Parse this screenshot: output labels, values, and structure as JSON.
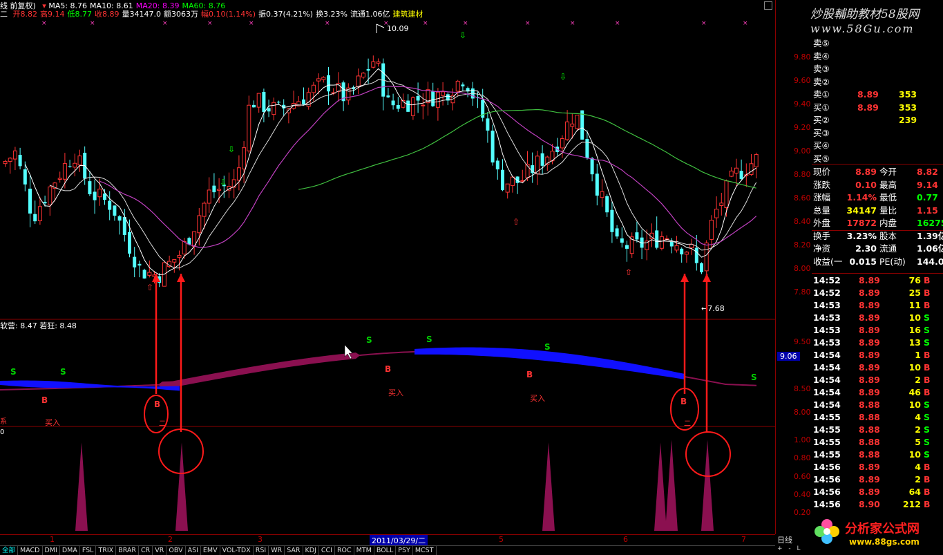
{
  "header": {
    "line1": {
      "title": "线 前复权)",
      "ma_items": [
        {
          "label": "MA5: 8.76",
          "color": "#ffffff"
        },
        {
          "label": "MA10: 8.61",
          "color": "#ffffff"
        },
        {
          "label": "MA20: 8.39",
          "color": "#ff00ff"
        },
        {
          "label": "MA60: 8.76",
          "color": "#00ff00"
        }
      ]
    },
    "line2": {
      "prefix": "二",
      "items": [
        {
          "label": "开8.82",
          "color": "#ff3333"
        },
        {
          "label": "高9.14",
          "color": "#ff3333"
        },
        {
          "label": "低8.77",
          "color": "#00ff00"
        },
        {
          "label": "收8.89",
          "color": "#ff3333"
        },
        {
          "label": "量34147.0",
          "color": "#ffffff"
        },
        {
          "label": "额3063万",
          "color": "#ffffff"
        },
        {
          "label": "幅0.10(1.14%)",
          "color": "#ff3333"
        },
        {
          "label": "振0.37(4.21%)",
          "color": "#ffffff"
        },
        {
          "label": "换3.23%",
          "color": "#ffffff"
        },
        {
          "label": "流通1.06亿",
          "color": "#ffffff"
        },
        {
          "label": "建筑建材",
          "color": "#ffff00"
        }
      ]
    }
  },
  "watermark": {
    "line1": "炒股輔助教材58股网",
    "line2": "www.58Gu.com"
  },
  "price_axis": [
    "9.80",
    "9.60",
    "9.40",
    "9.20",
    "9.00",
    "8.80",
    "8.60",
    "8.40",
    "8.20",
    "8.00",
    "7.80"
  ],
  "indicator_axis": [
    "9.50",
    "9.06",
    "8.50",
    "8.00"
  ],
  "volume_axis": [
    "1.00",
    "0.80",
    "0.60",
    "0.40",
    "0.20"
  ],
  "annotations": {
    "high": "10.09",
    "low": "7.68"
  },
  "indicator_header": "软营: 8.47 若狂: 8.48",
  "signals": {
    "s": "S",
    "b": "B",
    "buy": "买入",
    "small_left": "系",
    "small_right": "二",
    "sub_zero": "0"
  },
  "dates": [
    "1",
    "2",
    "3",
    "2011/03/29/二",
    "5",
    "6",
    "7"
  ],
  "order_book": {
    "sells": [
      {
        "label": "卖⑤",
        "price": "",
        "vol": ""
      },
      {
        "label": "卖④",
        "price": "",
        "vol": ""
      },
      {
        "label": "卖③",
        "price": "",
        "vol": ""
      },
      {
        "label": "卖②",
        "price": "",
        "vol": ""
      },
      {
        "label": "卖①",
        "price": "8.89",
        "vol": "353"
      }
    ],
    "buys": [
      {
        "label": "买①",
        "price": "8.89",
        "vol": "353"
      },
      {
        "label": "买②",
        "price": "",
        "vol": "239"
      },
      {
        "label": "买③",
        "price": "",
        "vol": ""
      },
      {
        "label": "买④",
        "price": "",
        "vol": ""
      },
      {
        "label": "买⑤",
        "price": "",
        "vol": ""
      }
    ]
  },
  "quote": [
    {
      "k1": "现价",
      "v1": "8.89",
      "c1": "#ff3333",
      "k2": "今开",
      "v2": "8.82",
      "c2": "#ff3333"
    },
    {
      "k1": "涨跌",
      "v1": "0.10",
      "c1": "#ff3333",
      "k2": "最高",
      "v2": "9.14",
      "c2": "#ff3333"
    },
    {
      "k1": "涨幅",
      "v1": "1.14%",
      "c1": "#ff3333",
      "k2": "最低",
      "v2": "0.77",
      "c2": "#00ff00"
    },
    {
      "k1": "总量",
      "v1": "34147",
      "c1": "#ffff00",
      "k2": "量比",
      "v2": "1.15",
      "c2": "#ff3333"
    },
    {
      "k1": "外盘",
      "v1": "17872",
      "c1": "#ff3333",
      "k2": "内盘",
      "v2": "16275",
      "c2": "#00ff00"
    },
    {
      "k1": "换手",
      "v1": "3.23%",
      "c1": "#ffffff",
      "k2": "股本",
      "v2": "1.39亿",
      "c2": "#ffffff"
    },
    {
      "k1": "净资",
      "v1": "2.30",
      "c1": "#ffffff",
      "k2": "流通",
      "v2": "1.06亿",
      "c2": "#ffffff"
    },
    {
      "k1": "收益(一",
      "v1": "0.015",
      "c1": "#ffffff",
      "k2": "PE(动)",
      "v2": "144.0",
      "c2": "#ffffff"
    }
  ],
  "ticks": [
    {
      "t": "14:52",
      "p": "8.89",
      "v": "76",
      "s": "B"
    },
    {
      "t": "14:52",
      "p": "8.89",
      "v": "25",
      "s": "B"
    },
    {
      "t": "14:53",
      "p": "8.89",
      "v": "11",
      "s": "B"
    },
    {
      "t": "14:53",
      "p": "8.89",
      "v": "10",
      "s": "S"
    },
    {
      "t": "14:53",
      "p": "8.89",
      "v": "16",
      "s": "S"
    },
    {
      "t": "14:53",
      "p": "8.89",
      "v": "13",
      "s": "S"
    },
    {
      "t": "14:54",
      "p": "8.89",
      "v": "1",
      "s": "B"
    },
    {
      "t": "14:54",
      "p": "8.89",
      "v": "10",
      "s": "B"
    },
    {
      "t": "14:54",
      "p": "8.89",
      "v": "2",
      "s": "B"
    },
    {
      "t": "14:54",
      "p": "8.89",
      "v": "46",
      "s": "B"
    },
    {
      "t": "14:54",
      "p": "8.88",
      "v": "10",
      "s": "S"
    },
    {
      "t": "14:55",
      "p": "8.88",
      "v": "4",
      "s": "S"
    },
    {
      "t": "14:55",
      "p": "8.88",
      "v": "2",
      "s": "S"
    },
    {
      "t": "14:55",
      "p": "8.88",
      "v": "5",
      "s": "S"
    },
    {
      "t": "14:55",
      "p": "8.88",
      "v": "10",
      "s": "S"
    },
    {
      "t": "14:56",
      "p": "8.89",
      "v": "4",
      "s": "B"
    },
    {
      "t": "14:56",
      "p": "8.89",
      "v": "2",
      "s": "B"
    },
    {
      "t": "14:56",
      "p": "8.89",
      "v": "64",
      "s": "B"
    },
    {
      "t": "14:56",
      "p": "8.90",
      "v": "212",
      "s": "B"
    }
  ],
  "period_label": "日线",
  "tabs": [
    "全部",
    "MACD",
    "DMI",
    "DMA",
    "FSL",
    "TRIX",
    "BRAR",
    "CR",
    "VR",
    "OBV",
    "ASI",
    "EMV",
    "VOL-TDX",
    "RSI",
    "WR",
    "SAR",
    "KDJ",
    "CCI",
    "ROC",
    "MTM",
    "BOLL",
    "PSY",
    "MCST"
  ],
  "logo": {
    "main": "分析家公式网",
    "sub": "www.88gs.com"
  },
  "colors": {
    "up": "#ff3333",
    "down": "#54ffff",
    "ma5": "#ffffff",
    "ma20": "#c040c0",
    "ma60": "#40c040",
    "band_blue": "#1010ff",
    "band_purple": "#8b1050"
  }
}
